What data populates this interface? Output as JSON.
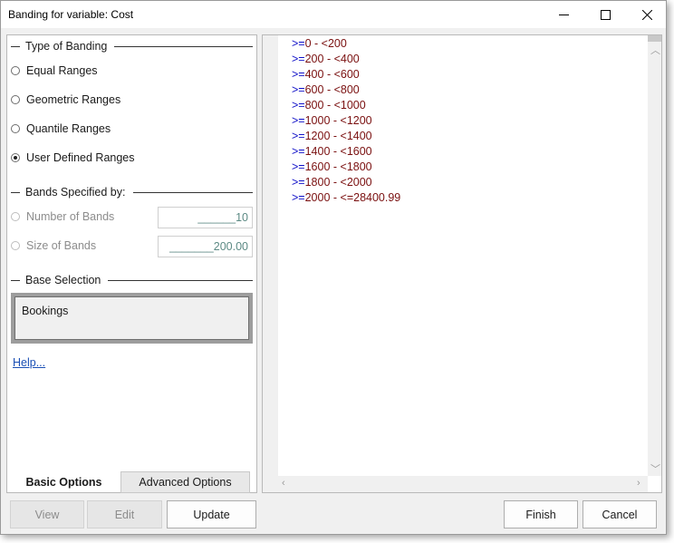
{
  "window": {
    "title": "Banding for variable: Cost"
  },
  "titlebar_buttons": {
    "minimize": "minimize-icon",
    "maximize": "maximize-icon",
    "close": "close-icon"
  },
  "type_of_banding": {
    "header": "Type of Banding",
    "options": [
      {
        "label": "Equal Ranges",
        "checked": false
      },
      {
        "label": "Geometric Ranges",
        "checked": false
      },
      {
        "label": "Quantile Ranges",
        "checked": false
      },
      {
        "label": "User Defined Ranges",
        "checked": true
      }
    ]
  },
  "bands_specified": {
    "header": "Bands Specified by:",
    "number_label": "Number of Bands",
    "number_value": "______10",
    "size_label": "Size of Bands",
    "size_value": "_______200.00",
    "enabled": false
  },
  "base_selection": {
    "header": "Base Selection",
    "value": "Bookings"
  },
  "help_link": "Help...",
  "tabs": {
    "basic": "Basic Options",
    "advanced": "Advanced Options",
    "active": "basic"
  },
  "ranges": [
    {
      "op": ">=",
      "text": "0 - <200"
    },
    {
      "op": ">=",
      "text": "200 - <400"
    },
    {
      "op": ">=",
      "text": "400 - <600"
    },
    {
      "op": ">=",
      "text": "600 - <800"
    },
    {
      "op": ">=",
      "text": "800 - <1000"
    },
    {
      "op": ">=",
      "text": "1000 - <1200"
    },
    {
      "op": ">=",
      "text": "1200 - <1400"
    },
    {
      "op": ">=",
      "text": "1400 - <1600"
    },
    {
      "op": ">=",
      "text": "1600 - <1800"
    },
    {
      "op": ">=",
      "text": "1800 - <2000"
    },
    {
      "op": ">=",
      "text": "2000 - <=28400.99"
    }
  ],
  "buttons": {
    "view": "View",
    "edit": "Edit",
    "update": "Update",
    "finish": "Finish",
    "cancel": "Cancel"
  },
  "colors": {
    "operator": "#1010c8",
    "range_value": "#7a1010",
    "link": "#1a4fb5"
  }
}
